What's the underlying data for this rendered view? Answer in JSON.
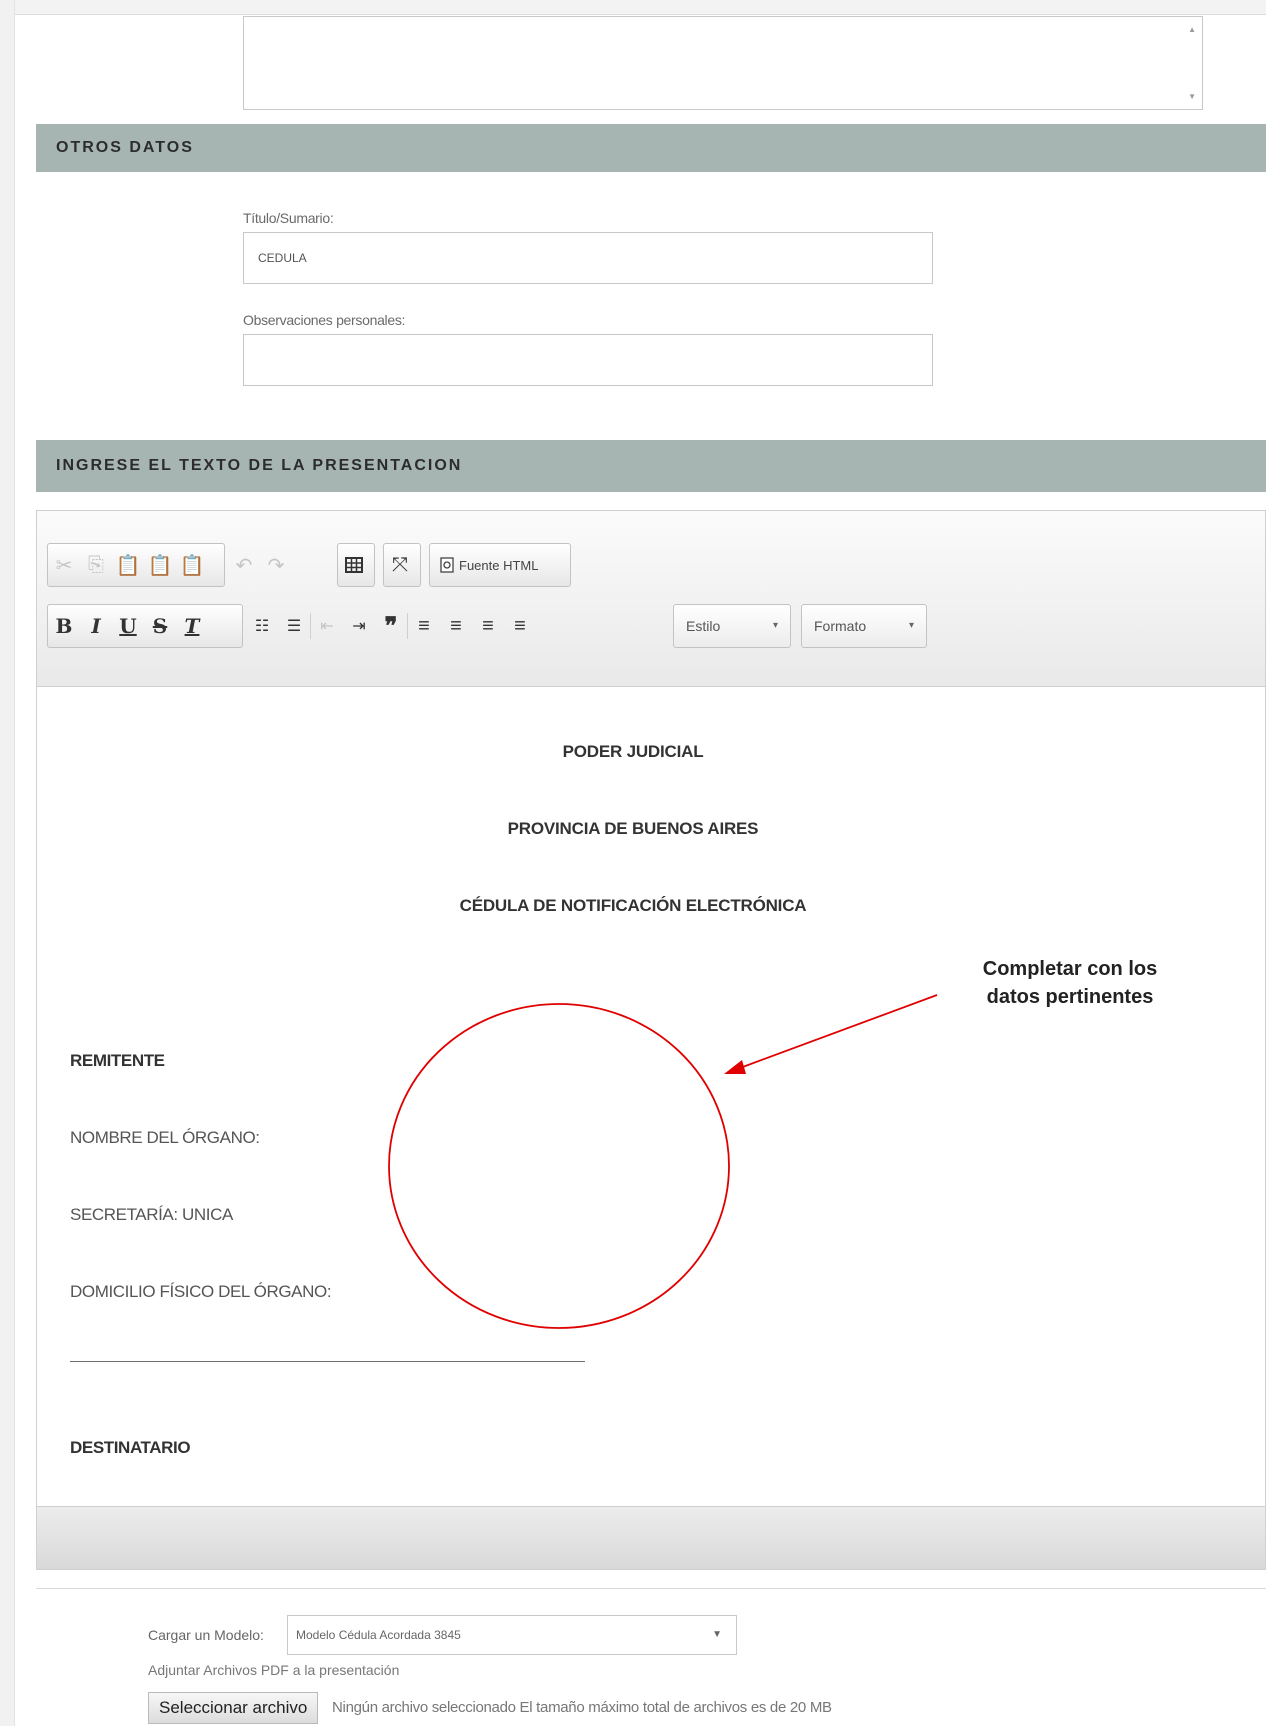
{
  "sections": {
    "otros_datos": "OTROS DATOS",
    "texto_presentacion": "INGRESE EL TEXTO DE LA PRESENTACION"
  },
  "fields": {
    "titulo_label": "Título/Sumario:",
    "titulo_value": "CEDULA",
    "observaciones_label": "Observaciones personales:",
    "observaciones_value": ""
  },
  "toolbar": {
    "source_label": "Fuente HTML",
    "style_combo": "Estilo",
    "format_combo": "Formato",
    "icons": [
      "cut-icon",
      "copy-icon",
      "paste-icon",
      "paste-text-icon",
      "paste-word-icon",
      "undo-icon",
      "redo-icon",
      "table-icon",
      "maximize-icon",
      "source-icon",
      "bold-icon",
      "italic-icon",
      "underline-icon",
      "strike-icon",
      "remove-format-icon",
      "numbered-list-icon",
      "bulleted-list-icon",
      "outdent-icon",
      "indent-icon",
      "blockquote-icon",
      "align-left-icon",
      "align-center-icon",
      "align-right-icon",
      "justify-icon"
    ]
  },
  "document": {
    "line1": "PODER JUDICIAL",
    "line2": "PROVINCIA DE BUENOS AIRES",
    "line3": "CÉDULA DE NOTIFICACIÓN ELECTRÓNICA",
    "remitente": "REMITENTE",
    "nombre_organo": "NOMBRE DEL ÓRGANO:",
    "secretaria": "SECRETARÍA: UNICA",
    "domicilio": "DOMICILIO FÍSICO DEL ÓRGANO:",
    "destinatario": "DESTINATARIO"
  },
  "annotation": {
    "line1": "Completar con los",
    "line2": "datos pertinentes",
    "color": "#e00000"
  },
  "bottom": {
    "model_label": "Cargar un Modelo:",
    "model_value": "Modelo Cédula Acordada 3845",
    "attach_label": "Adjuntar Archivos PDF a la presentación",
    "file_button": "Seleccionar archivo",
    "file_status": "Ningún archivo seleccionado El tamaño máximo total de archivos es de 20 MB"
  },
  "colors": {
    "section_bar": "#a7b5b2",
    "annotation_red": "#e00000"
  }
}
